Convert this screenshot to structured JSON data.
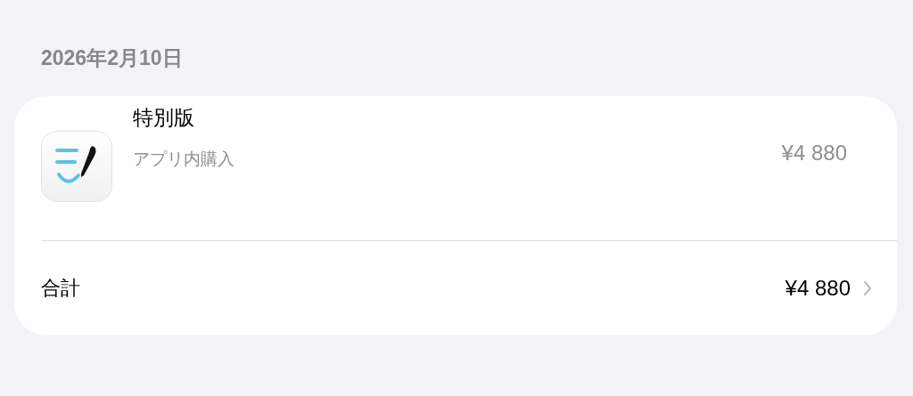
{
  "date": "2026年2月10日",
  "items": [
    {
      "name": "特別版",
      "type": "アプリ内購入",
      "price": "¥4 880"
    }
  ],
  "total": {
    "label": "合計",
    "amount": "¥4 880"
  }
}
